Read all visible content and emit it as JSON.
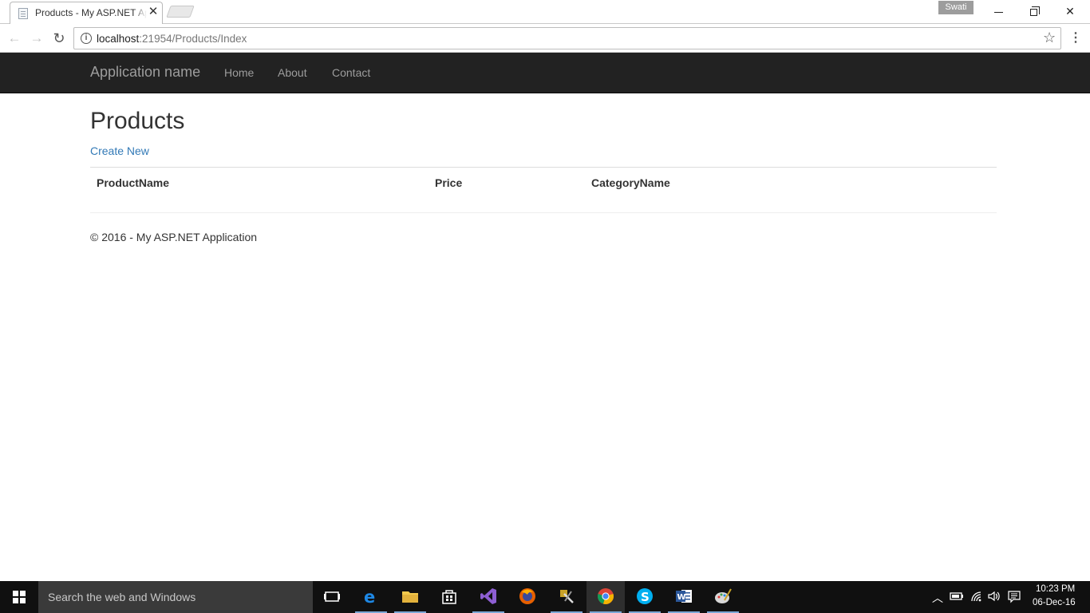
{
  "browser": {
    "tab_title": "Products - My ASP.NET Application",
    "user_badge": "Swati",
    "url_host": "localhost",
    "url_path": ":21954/Products/Index"
  },
  "navbar": {
    "brand": "Application name",
    "links": [
      "Home",
      "About",
      "Contact"
    ]
  },
  "page": {
    "title": "Products",
    "create_link": "Create New",
    "table_headers": [
      "ProductName",
      "Price",
      "CategoryName"
    ],
    "footer": "© 2016 - My ASP.NET Application"
  },
  "taskbar": {
    "search_placeholder": "Search the web and Windows",
    "apps": [
      "task-view",
      "edge",
      "file-explorer",
      "store",
      "visual-studio",
      "firefox",
      "tools",
      "chrome",
      "skype",
      "word",
      "paint"
    ],
    "time": "10:23 PM",
    "date": "06-Dec-16"
  },
  "colors": {
    "navbar_bg": "#222222",
    "navbar_text": "#9d9d9d",
    "link": "#337ab7",
    "taskbar_bg": "#101010"
  }
}
